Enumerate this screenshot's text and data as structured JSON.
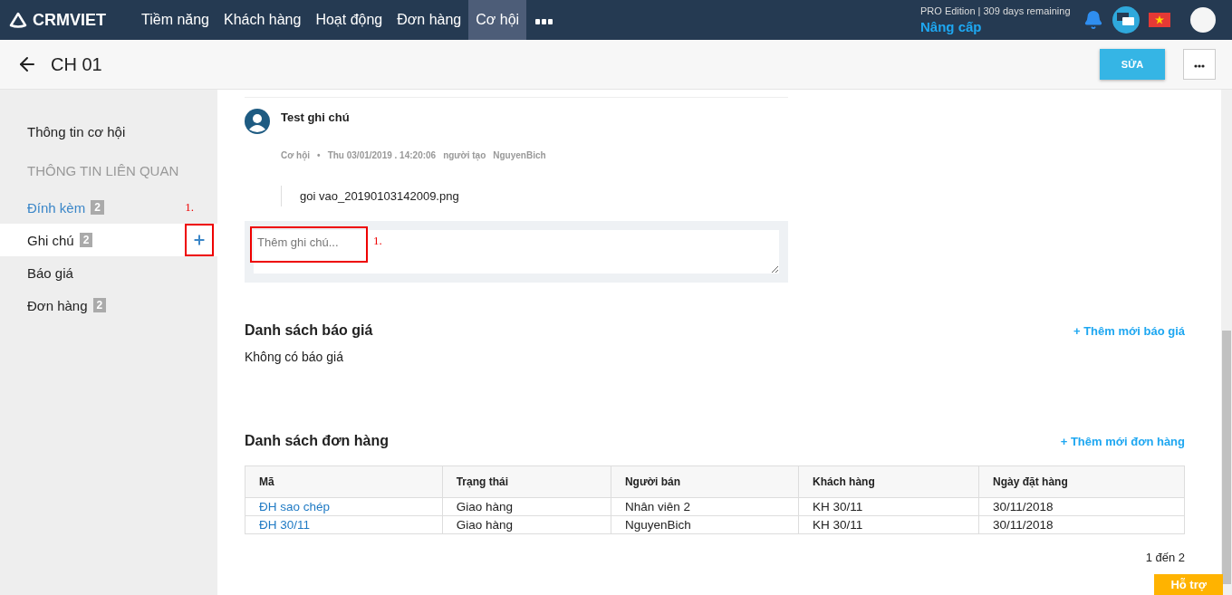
{
  "brand": {
    "name": "CRMVIET"
  },
  "nav": [
    {
      "label": "Tiềm năng",
      "selected": false
    },
    {
      "label": "Khách hàng",
      "selected": false
    },
    {
      "label": "Hoạt động",
      "selected": false
    },
    {
      "label": "Đơn hàng",
      "selected": false
    },
    {
      "label": "Cơ hội",
      "selected": true
    }
  ],
  "edition": {
    "text": "PRO Edition | 309 days remaining",
    "upgrade": "Nâng cấp"
  },
  "page": {
    "title": "CH 01",
    "edit_button": "SỬA"
  },
  "sidebar": {
    "info": "Thông tin cơ hội",
    "section": "THÔNG TIN LIÊN QUAN",
    "items": [
      {
        "label": "Đính kèm",
        "count": "2",
        "selected": false,
        "link": true,
        "annotation": "1."
      },
      {
        "label": "Ghi chú",
        "count": "2",
        "selected": true,
        "link": false
      },
      {
        "label": "Báo giá",
        "selected": false,
        "link": false
      },
      {
        "label": "Đơn hàng",
        "count": "2",
        "selected": false,
        "link": false
      }
    ]
  },
  "note": {
    "title": "Test ghi chú",
    "type": "Cơ hội",
    "separator": "•",
    "date": "Thu 03/01/2019 . 14:20:06",
    "creator_label": "người tạo",
    "creator": "NguyenBich",
    "attachment": "goi vao_20190103142009.png"
  },
  "note_input": {
    "placeholder": "Thêm ghi chú...",
    "annotation": "1."
  },
  "quotes": {
    "title": "Danh sách báo giá",
    "add": "+ Thêm mới báo giá",
    "empty": "Không có báo giá"
  },
  "orders": {
    "title": "Danh sách đơn hàng",
    "add": "+ Thêm mới đơn hàng",
    "columns": [
      "Mã",
      "Trạng thái",
      "Người bán",
      "Khách hàng",
      "Ngày đặt hàng"
    ],
    "rows": [
      [
        "ĐH sao chép",
        "Giao hàng",
        "Nhân viên 2",
        "KH 30/11",
        "30/11/2018"
      ],
      [
        "ĐH 30/11",
        "Giao hàng",
        "NguyenBich",
        "KH 30/11",
        "30/11/2018"
      ]
    ],
    "pagination": "1 đến 2"
  },
  "support": "Hỗ trợ"
}
